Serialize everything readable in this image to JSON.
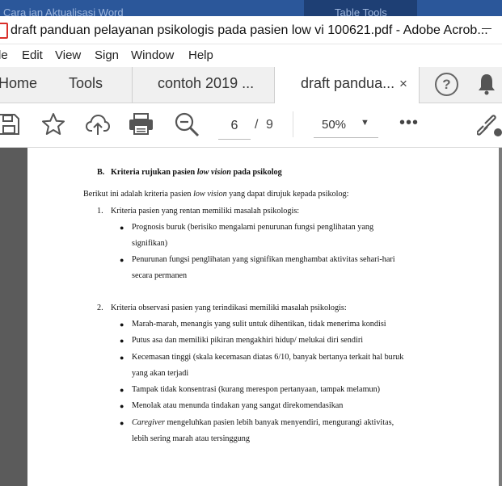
{
  "background_window": {
    "left_text": "Cara ian Aktualisasi     Word",
    "right_text": "Table Tools"
  },
  "window": {
    "title": "draft panduan pelayanan psikologis pada pasien low vi 100621.pdf - Adobe Acrob..."
  },
  "menu": [
    "le",
    "Edit",
    "View",
    "Sign",
    "Window",
    "Help"
  ],
  "tabs": {
    "home": "Home",
    "tools": "Tools",
    "doc1": "contoh 2019 ...",
    "doc2": "draft pandua...",
    "close": "×",
    "help": "?"
  },
  "toolbar": {
    "page_current": "6",
    "page_sep": "/",
    "page_total": "9",
    "zoom": "50%",
    "zoom_caret": "▼",
    "more": "•••"
  },
  "document": {
    "heading": {
      "prefix": "B.",
      "text_1": "Kriteria rujukan pasien ",
      "italic": "low vision",
      "text_2": " pada psikolog"
    },
    "intro": {
      "text_1": "Berikut ini adalah kriteria pasien ",
      "italic": "low vision",
      "text_2": " yang dapat dirujuk kepada psikolog:"
    },
    "section1": {
      "number": "1.",
      "title": "Kriteria pasien yang rentan memiliki masalah psikologis:",
      "bullets": [
        {
          "line1": "Prognosis buruk (berisiko mengalami penurunan fungsi penglihatan yang",
          "line2": "signifikan)"
        },
        {
          "line1": "Penurunan fungsi penglihatan yang signifikan menghambat aktivitas sehari-hari",
          "line2": "secara permanen"
        }
      ]
    },
    "section2": {
      "number": "2.",
      "title": "Kriteria observasi pasien yang terindikasi memiliki masalah psikologis:",
      "bullets": [
        {
          "line1": "Marah-marah, menangis yang sulit untuk dihentikan, tidak menerima kondisi"
        },
        {
          "line1": "Putus asa dan memiliki pikiran mengakhiri hidup/ melukai diri sendiri"
        },
        {
          "line1": "Kecemasan tinggi (skala kecemasan diatas 6/10, banyak bertanya terkait hal buruk",
          "line2": "yang akan terjadi"
        },
        {
          "line1": "Tampak tidak konsentrasi (kurang merespon pertanyaan, tampak melamun)"
        },
        {
          "line1": "Menolak atau menunda tindakan yang sangat direkomendasikan"
        },
        {
          "italic": "Caregiver",
          "line1": " mengeluhkan pasien lebih banyak menyendiri, mengurangi aktivitas,",
          "line2": "lebih sering marah atau tersinggung"
        }
      ]
    }
  },
  "colors": {
    "background_window": "#2b579a",
    "tab_bar": "#f0f0f0",
    "document_gutter": "#5b5b5b",
    "icon": "#555555"
  }
}
